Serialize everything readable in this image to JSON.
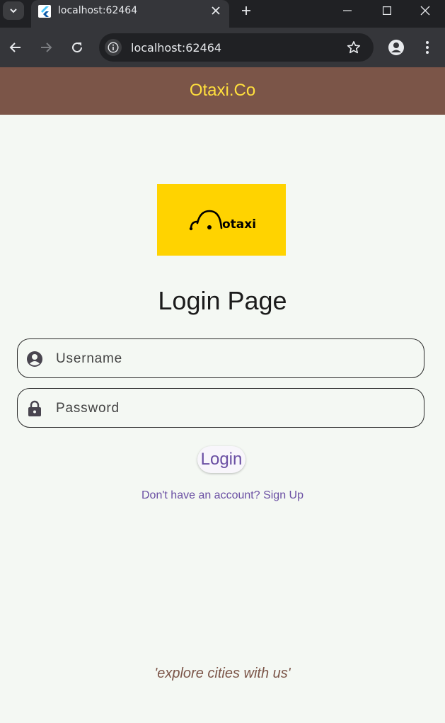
{
  "browser": {
    "tab_title": "localhost:62464",
    "address": "localhost:62464",
    "icons": [
      "tab-list-icon",
      "flutter-favicon-icon",
      "close-icon",
      "plus-icon",
      "minimize-icon",
      "maximize-icon",
      "window-close-icon",
      "back-icon",
      "forward-icon",
      "reload-icon",
      "info-icon",
      "star-icon",
      "profile-icon",
      "more-vert-icon"
    ]
  },
  "app": {
    "title": "Otaxi.Co",
    "colors": {
      "appbar": "#7b5548",
      "title": "#ffdf3d",
      "accent": "#6a4fa3",
      "logo_bg": "#ffd300"
    }
  },
  "logo": {
    "text": "otaxi"
  },
  "login": {
    "heading": "Login Page",
    "username_placeholder": "Username",
    "password_placeholder": "Password",
    "button_label": "Login",
    "signup_link": "Don't have an account? Sign Up"
  },
  "footer": {
    "tagline": "'explore cities with us'"
  }
}
